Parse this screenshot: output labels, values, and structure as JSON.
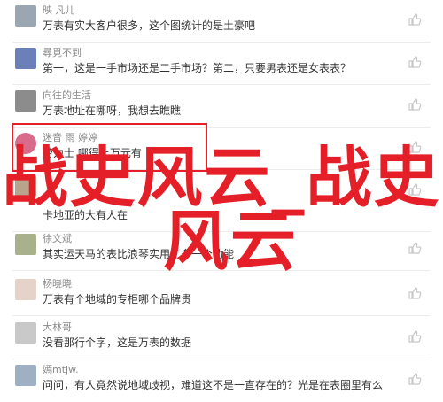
{
  "items": [
    {
      "name": "映 凡儿",
      "msg": "万表有实大客户很多，这个图统计的是土豪吧",
      "avatar_color": "#9aa6b2"
    },
    {
      "name": "尋覓不到",
      "msg": "第一，这是一手市场还是二手市场？第二，只要男表还是女表表？",
      "avatar_color": "#6b7fb8"
    },
    {
      "name": "向往的生活",
      "msg": "万表地址在哪呀，我想去瞧瞧",
      "avatar_color": "#8c8c8c"
    },
    {
      "name": "迷音 雨 婷婷",
      "msg": "劳力士 哪得上万元有",
      "avatar_color": "#d86a8a"
    },
    {
      "name": "",
      "msg": "",
      "avatar_color": "#b7a48a"
    },
    {
      "name": "",
      "msg": "卡地亚的大有人在",
      "avatar_color": "#7f8c99"
    },
    {
      "name": "徐文斌",
      "msg": "其实运天马的表比浪琴实用，多一个功能",
      "avatar_color": "#a9b08c"
    },
    {
      "name": "杨晓晓",
      "msg": "万表有个地域的专柜哪个品牌贵",
      "avatar_color": "#e5d2c8"
    },
    {
      "name": "大林哥",
      "msg": "没看那行个字，这是万表的数据",
      "avatar_color": "#c9c9c9"
    },
    {
      "name": "嫣mtjw.",
      "msg": "问问，有人竟然说地域歧视，难道这不是一直存在的？光是在表圈里有么",
      "avatar_color": "#9fb0c4"
    }
  ],
  "overlay": {
    "line1": "战史风云_战史",
    "line2": "风云"
  },
  "colors": {
    "accent": "#e41f27",
    "like_icon": "#c7c7c7"
  }
}
